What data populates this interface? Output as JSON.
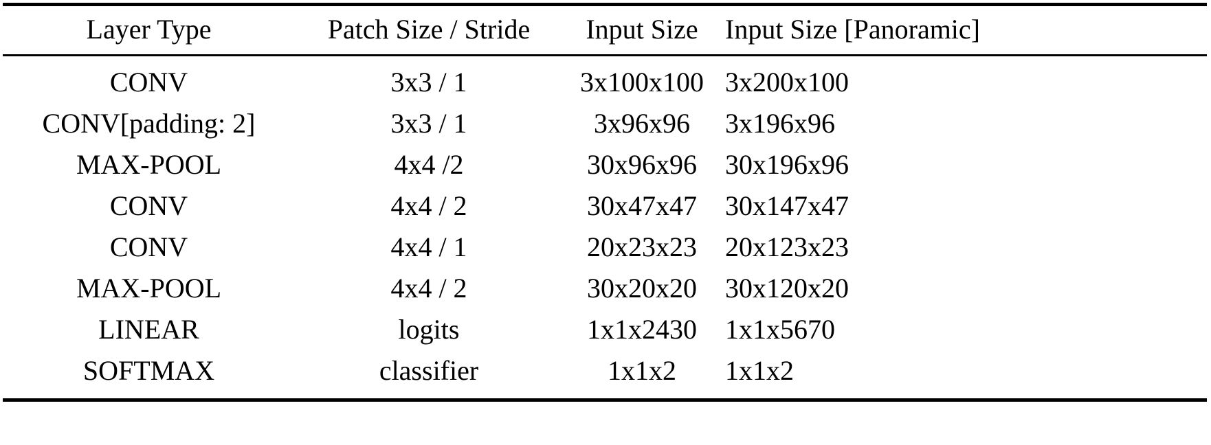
{
  "table": {
    "columns": [
      {
        "key": "layer_type",
        "label": "Layer Type",
        "align": "center"
      },
      {
        "key": "patch_stride",
        "label": "Patch Size / Stride",
        "align": "center"
      },
      {
        "key": "input_size",
        "label": "Input Size",
        "align": "center"
      },
      {
        "key": "input_size_panoramic",
        "label": "Input Size [Panoramic]",
        "align": "left"
      }
    ],
    "headers": {
      "layer_type": "Layer Type",
      "patch_stride": "Patch Size / Stride",
      "input_size": "Input Size",
      "input_size_panoramic": "Input Size [Panoramic]"
    },
    "rows": [
      {
        "layer_type": "CONV",
        "patch_stride": "3x3 / 1",
        "input_size": "3x100x100",
        "input_size_panoramic": "3x200x100"
      },
      {
        "layer_type": "CONV[padding: 2]",
        "patch_stride": "3x3 / 1",
        "input_size": "3x96x96",
        "input_size_panoramic": "3x196x96"
      },
      {
        "layer_type": "MAX-POOL",
        "patch_stride": "4x4 /2",
        "input_size": "30x96x96",
        "input_size_panoramic": "30x196x96"
      },
      {
        "layer_type": "CONV",
        "patch_stride": "4x4 / 2",
        "input_size": "30x47x47",
        "input_size_panoramic": "30x147x47"
      },
      {
        "layer_type": "CONV",
        "patch_stride": "4x4 / 1",
        "input_size": "20x23x23",
        "input_size_panoramic": "20x123x23"
      },
      {
        "layer_type": "MAX-POOL",
        "patch_stride": "4x4 / 2",
        "input_size": "30x20x20",
        "input_size_panoramic": "30x120x20"
      },
      {
        "layer_type": "LINEAR",
        "patch_stride": "logits",
        "input_size": "1x1x2430",
        "input_size_panoramic": "1x1x5670"
      },
      {
        "layer_type": "SOFTMAX",
        "patch_stride": "classifier",
        "input_size": "1x1x2",
        "input_size_panoramic": "1x1x2"
      }
    ]
  },
  "style": {
    "text_color": "#000000",
    "background_color": "#ffffff",
    "rule_color": "#000000"
  }
}
